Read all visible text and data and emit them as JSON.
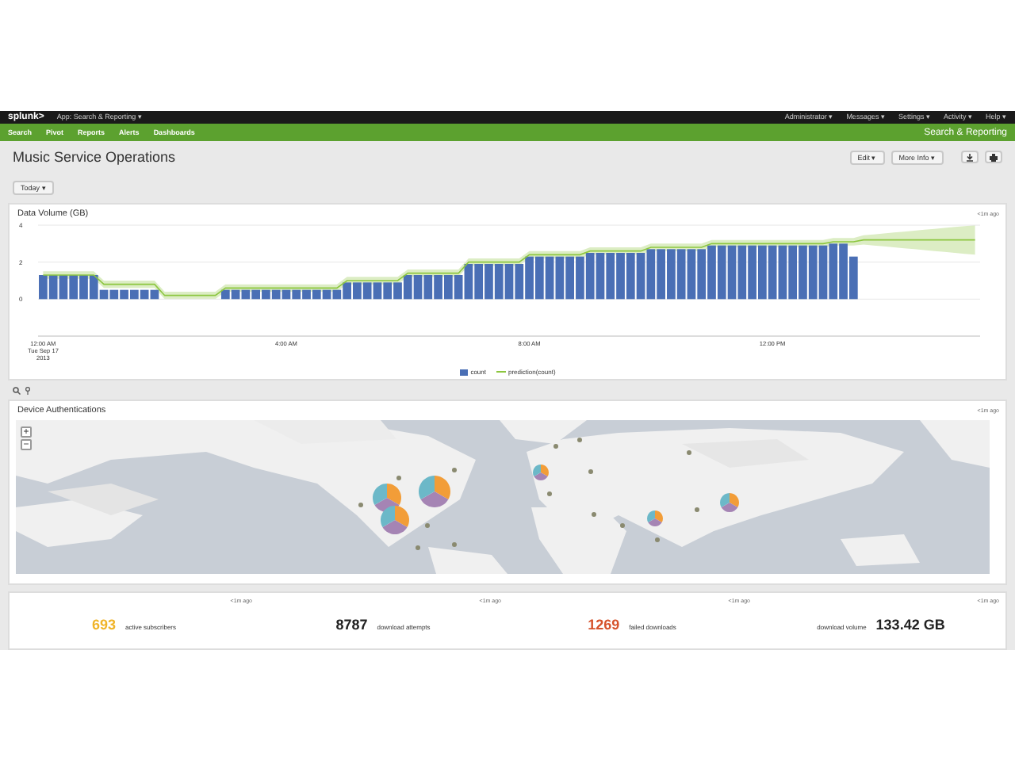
{
  "top_bar": {
    "logo": "splunk>",
    "app_menu": "App: Search & Reporting ▾",
    "menus": [
      "Administrator ▾",
      "Messages ▾",
      "Settings ▾",
      "Activity ▾",
      "Help ▾"
    ]
  },
  "nav_bar": {
    "items": [
      "Search",
      "Pivot",
      "Reports",
      "Alerts",
      "Dashboards"
    ],
    "app_title": "Search & Reporting"
  },
  "dashboard": {
    "title": "Music Service Operations",
    "buttons": [
      "Edit ▾",
      "More Info ▾"
    ],
    "time_picker": "Today ▾"
  },
  "volume_panel": {
    "title": "Data Volume (GB)",
    "updated": "<1m ago",
    "chart_data": {
      "type": "bar",
      "categories": [
        "12:00 AM\nTue Sep 17\n2013",
        null,
        null,
        null,
        null,
        null,
        null,
        null,
        null,
        null,
        null,
        null,
        null,
        null,
        null,
        null,
        null,
        null,
        null,
        null,
        null,
        null,
        null,
        null,
        "4:00 AM",
        null,
        null,
        null,
        null,
        null,
        null,
        null,
        null,
        null,
        null,
        null,
        null,
        null,
        null,
        null,
        null,
        null,
        null,
        null,
        null,
        null,
        null,
        null,
        "8:00 AM",
        null,
        null,
        null,
        null,
        null,
        null,
        null,
        null,
        null,
        null,
        null,
        null,
        null,
        null,
        null,
        null,
        null,
        null,
        null,
        null,
        null,
        null,
        null,
        "12:00 PM",
        null,
        null,
        null,
        null,
        null,
        null,
        null,
        null,
        null,
        null,
        null,
        null,
        null,
        null,
        null,
        null,
        null,
        null,
        null,
        null
      ],
      "series": [
        {
          "name": "count",
          "color": "#4a6fb5",
          "values": [
            1.3,
            1.3,
            1.3,
            1.3,
            1.3,
            1.3,
            0.5,
            0.5,
            0.5,
            0.5,
            0.5,
            0.5,
            null,
            null,
            null,
            null,
            null,
            null,
            0.5,
            0.5,
            0.5,
            0.5,
            0.5,
            0.5,
            0.5,
            0.5,
            0.5,
            0.5,
            0.5,
            0.5,
            0.9,
            0.9,
            0.9,
            0.9,
            0.9,
            0.9,
            1.3,
            1.3,
            1.3,
            1.3,
            1.3,
            1.3,
            1.9,
            1.9,
            1.9,
            1.9,
            1.9,
            1.9,
            2.3,
            2.3,
            2.3,
            2.3,
            2.3,
            2.3,
            2.5,
            2.5,
            2.5,
            2.5,
            2.5,
            2.5,
            2.7,
            2.7,
            2.7,
            2.7,
            2.7,
            2.7,
            2.9,
            2.9,
            2.9,
            2.9,
            2.9,
            2.9,
            2.9,
            2.9,
            2.9,
            2.9,
            2.9,
            2.9,
            3.0,
            3.0,
            2.3,
            null,
            null,
            null,
            null,
            null,
            null,
            null,
            null,
            null,
            null,
            null,
            null
          ]
        },
        {
          "name": "prediction(count)",
          "type": "line",
          "color": "#8cc63f",
          "values": [
            1.3,
            1.3,
            1.3,
            1.3,
            1.3,
            1.3,
            0.8,
            0.8,
            0.8,
            0.8,
            0.8,
            0.8,
            0.2,
            0.2,
            0.2,
            0.2,
            0.2,
            0.2,
            0.6,
            0.6,
            0.6,
            0.6,
            0.6,
            0.6,
            0.6,
            0.6,
            0.6,
            0.6,
            0.6,
            0.6,
            1.0,
            1.0,
            1.0,
            1.0,
            1.0,
            1.0,
            1.4,
            1.4,
            1.4,
            1.4,
            1.4,
            1.4,
            2.0,
            2.0,
            2.0,
            2.0,
            2.0,
            2.0,
            2.4,
            2.4,
            2.4,
            2.4,
            2.4,
            2.4,
            2.6,
            2.6,
            2.6,
            2.6,
            2.6,
            2.6,
            2.8,
            2.8,
            2.8,
            2.8,
            2.8,
            2.8,
            3.0,
            3.0,
            3.0,
            3.0,
            3.0,
            3.0,
            3.0,
            3.0,
            3.0,
            3.0,
            3.0,
            3.0,
            3.1,
            3.1,
            3.1,
            3.2,
            3.2,
            3.2,
            3.2,
            3.2,
            3.2,
            3.2,
            3.2,
            3.2,
            3.2,
            3.2,
            3.2
          ]
        }
      ],
      "ylim": [
        -2,
        4
      ],
      "yticks": [
        0,
        2,
        4
      ],
      "grid": true
    }
  },
  "map_panel": {
    "title": "Device Authentications",
    "updated": "<1m ago",
    "zoom_controls": [
      "+",
      "−"
    ],
    "map": {
      "kind": "picture"
    }
  },
  "stats": [
    {
      "kind": "value_first",
      "value": "693",
      "label": "active subscribers",
      "updated": "<1m ago",
      "color": "#f0b429"
    },
    {
      "kind": "value_first",
      "value": "8787",
      "label": "download attempts",
      "updated": "<1m ago",
      "color": "#222222"
    },
    {
      "kind": "value_first",
      "value": "1269",
      "label": "failed downloads",
      "updated": "<1m ago",
      "color": "#d6532c"
    },
    {
      "kind": "label_first",
      "value": "133.42 GB",
      "label": "download volume",
      "updated": "<1m ago",
      "color": "#222222"
    }
  ]
}
